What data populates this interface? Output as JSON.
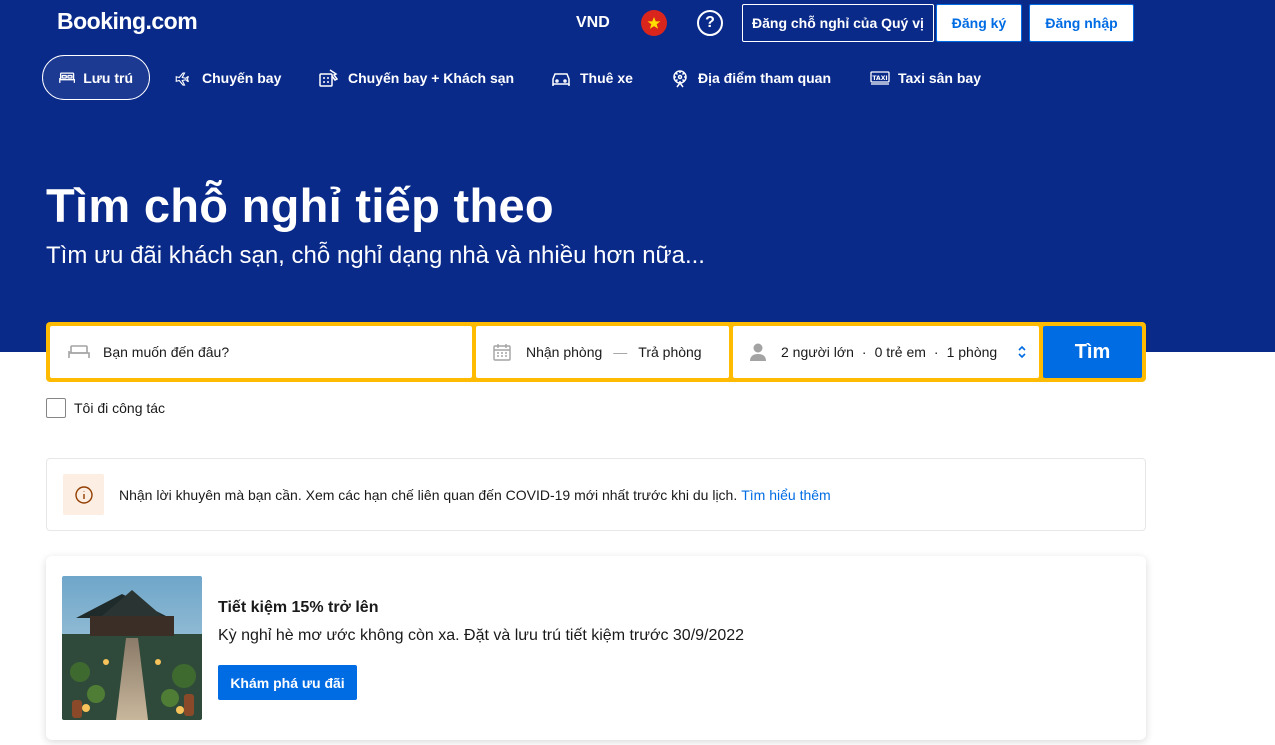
{
  "header": {
    "logo": "Booking.com",
    "currency": "VND",
    "list_property": "Đăng chỗ nghỉ của Quý vị",
    "register": "Đăng ký",
    "login": "Đăng nhập"
  },
  "nav": {
    "tabs": [
      {
        "label": "Lưu trú",
        "icon": "bed-icon",
        "active": true
      },
      {
        "label": "Chuyến bay",
        "icon": "airplane-icon"
      },
      {
        "label": "Chuyến bay + Khách sạn",
        "icon": "flight-hotel-icon"
      },
      {
        "label": "Thuê xe",
        "icon": "car-icon"
      },
      {
        "label": "Địa điểm tham quan",
        "icon": "attractions-icon"
      },
      {
        "label": "Taxi sân bay",
        "icon": "taxi-icon"
      }
    ]
  },
  "hero": {
    "title": "Tìm chỗ nghỉ tiếp theo",
    "subtitle": "Tìm ưu đãi khách sạn, chỗ nghỉ dạng nhà và nhiều hơn nữa..."
  },
  "search": {
    "destination_placeholder": "Bạn muốn đến đâu?",
    "checkin": "Nhận phòng",
    "separator": "—",
    "checkout": "Trả phòng",
    "adults": "2 người lớn",
    "children": "0 trẻ em",
    "rooms": "1 phòng",
    "dot": "·",
    "submit": "Tìm"
  },
  "business_trip": {
    "label": "Tôi đi công tác"
  },
  "covid_notice": {
    "text": "Nhận lời khuyên mà bạn cần. Xem các hạn chế liên quan đến COVID-19 mới nhất trước khi du lịch.",
    "link": "Tìm hiểu thêm"
  },
  "promo": {
    "title": "Tiết kiệm 15% trở lên",
    "description": "Kỳ nghỉ hè mơ ước không còn xa. Đặt và lưu trú tiết kiệm trước 30/9/2022",
    "button": "Khám phá ưu đãi"
  },
  "colors": {
    "brand_dark": "#0a2a8a",
    "primary_blue": "#006ce4",
    "search_yellow": "#febb02"
  }
}
